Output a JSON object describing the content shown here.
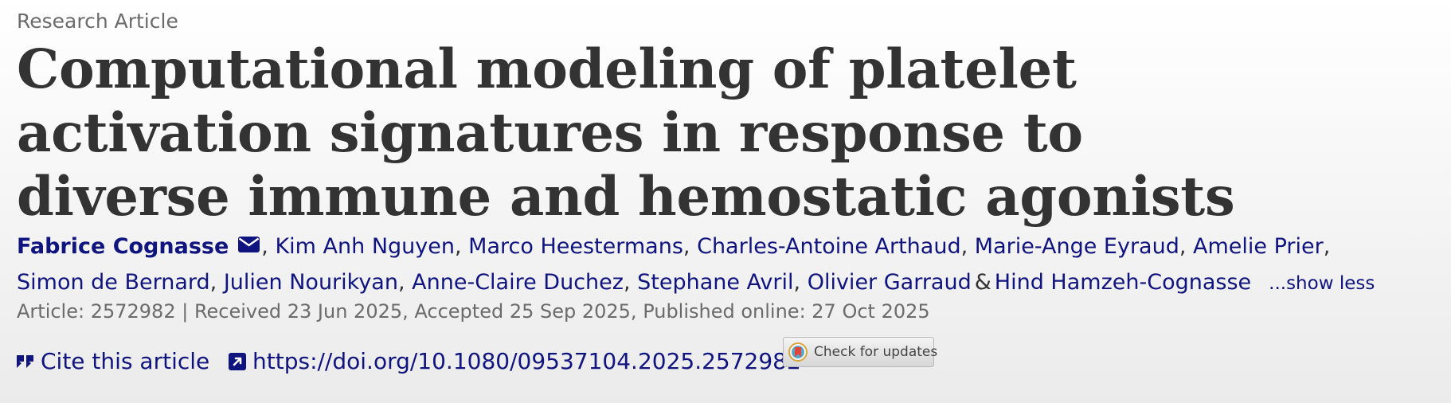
{
  "article": {
    "type": "Research Article",
    "title": "Computational modeling of platelet activation signatures in response to diverse immune and hemostatic agonists"
  },
  "authors": [
    {
      "name": "Fabrice Cognasse",
      "corresponding": true
    },
    {
      "name": "Kim Anh Nguyen"
    },
    {
      "name": "Marco Heestermans"
    },
    {
      "name": "Charles-Antoine Arthaud"
    },
    {
      "name": "Marie-Ange Eyraud"
    },
    {
      "name": "Amelie Prier"
    },
    {
      "name": "Simon de Bernard"
    },
    {
      "name": "Julien Nourikyan"
    },
    {
      "name": "Anne-Claire Duchez"
    },
    {
      "name": "Stephane Avril"
    },
    {
      "name": "Olivier Garraud"
    },
    {
      "name": "Hind Hamzeh-Cognasse"
    }
  ],
  "authors_toggle": "...show less",
  "ampersand": "&",
  "meta": {
    "line": "Article: 2572982 | Received 23 Jun 2025, Accepted 25 Sep 2025, Published online: 27 Oct 2025"
  },
  "actions": {
    "cite_label": "Cite this article",
    "doi_url": "https://doi.org/10.1080/09537104.2025.2572982",
    "updates_label": "Check for updates"
  },
  "icons": {
    "corresponding": "envelope-icon",
    "cite": "quote-icon",
    "doi": "external-link-icon",
    "updates": "crossmark-icon"
  },
  "colors": {
    "link": "#10147e",
    "title": "#333333",
    "muted": "#6b6b6b"
  }
}
